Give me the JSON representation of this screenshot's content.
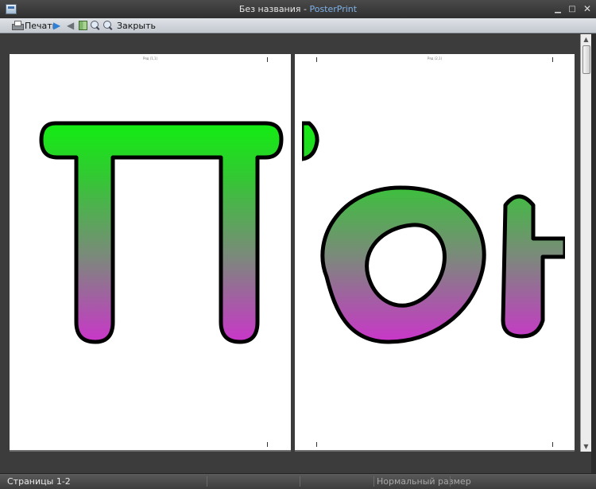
{
  "window": {
    "document_name": "Без названия",
    "separator": " - ",
    "app_name": "PosterPrint",
    "minimize": "▁",
    "maximize": "□",
    "close": "✕"
  },
  "toolbar": {
    "print_label": "Печать",
    "next_glyph": "▶",
    "prev_glyph": "◀",
    "close_label": "Закрыть"
  },
  "pages": [
    {
      "label": "Ряд (1,1)",
      "letter": "П"
    },
    {
      "label": "Ряд (2,1)",
      "letter": "ок"
    }
  ],
  "statusbar": {
    "pages_text": "Страницы 1-2",
    "zoom_text": "Нормальный размер"
  },
  "colors": {
    "gradient_top": "#11ee11",
    "gradient_mid": "#6a9a6a",
    "gradient_bottom": "#cc33cc",
    "outline": "#000000",
    "app_accent": "#7fb2e8"
  },
  "icons": {
    "print": "printer-icon",
    "next": "next-page-icon",
    "prev": "previous-page-icon",
    "view": "book-view-icon",
    "zoom_in": "zoom-in-icon",
    "zoom_out": "zoom-out-icon"
  }
}
